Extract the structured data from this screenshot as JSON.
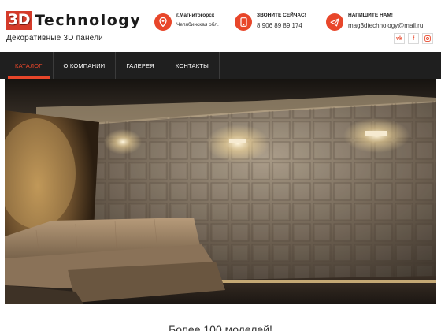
{
  "brand": {
    "logo_mark": "3D",
    "logo_word": "Technology",
    "tagline": "Декоративные 3D панели"
  },
  "contacts": {
    "location": {
      "title": "г.Магнитогорск",
      "subtitle": "Челябинская обл.",
      "icon": "map-pin-icon"
    },
    "phone": {
      "title": "ЗВОНИТЕ СЕЙЧАС!",
      "subtitle": "8 906 89 89 174",
      "icon": "phone-icon"
    },
    "email": {
      "title": "НАПИШИТЕ НАМ!",
      "subtitle": "mag3dtechnology@mail.ru",
      "icon": "send-icon"
    }
  },
  "social": {
    "vk": "vk",
    "facebook": "f",
    "instagram": "instagram-icon"
  },
  "nav": {
    "items": [
      {
        "label": "КАТАЛОГ",
        "active": true
      },
      {
        "label": "О КОМПАНИИ",
        "active": false
      },
      {
        "label": "ГАЛЕРЕЯ",
        "active": false
      },
      {
        "label": "КОНТАКТЫ",
        "active": false
      }
    ]
  },
  "bottom": {
    "heading": "Более 100 моделей!"
  },
  "colors": {
    "accent": "#e8462a",
    "nav_bg": "#1f1f1f"
  }
}
